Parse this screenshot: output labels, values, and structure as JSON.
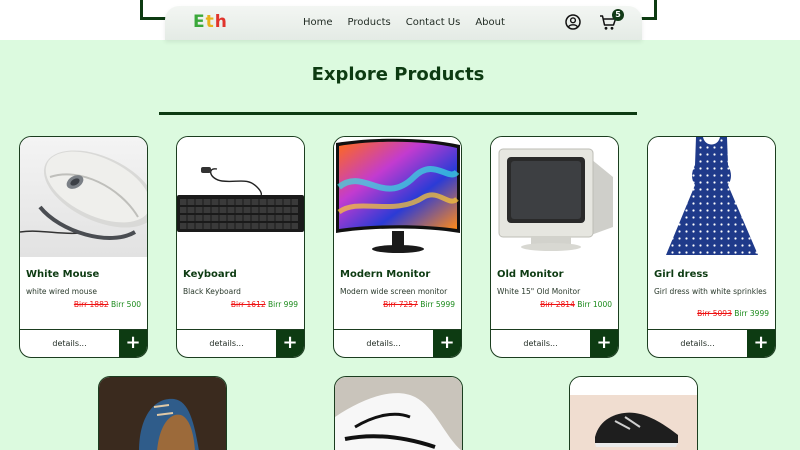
{
  "nav": {
    "logo": {
      "l1": "E",
      "l2": "t",
      "l3": "h"
    },
    "links": [
      "Home",
      "Products",
      "Contact Us",
      "About"
    ],
    "cart_count": "5"
  },
  "page": {
    "title": "Explore Products"
  },
  "products": [
    {
      "name": "White Mouse",
      "desc": "white wired mouse",
      "old_price": "Birr 1882",
      "price": "Birr 500",
      "details": "details...",
      "add": "+"
    },
    {
      "name": "Keyboard",
      "desc": "Black Keyboard",
      "old_price": "Birr 1612",
      "price": "Birr 999",
      "details": "details...",
      "add": "+"
    },
    {
      "name": "Modern Monitor",
      "desc": "Modern wide screen monitor",
      "old_price": "Birr 7257",
      "price": "Birr 5999",
      "details": "details...",
      "add": "+"
    },
    {
      "name": "Old Monitor",
      "desc": "White 15\" Old Monitor",
      "old_price": "Birr 2814",
      "price": "Birr 1000",
      "details": "details...",
      "add": "+"
    },
    {
      "name": "Girl dress",
      "desc": "Girl dress with white sprinkles",
      "old_price": "Birr 5093",
      "price": "Birr 3999",
      "details": "details...",
      "add": "+"
    }
  ],
  "colors": {
    "accent": "#0d3b12",
    "background": "#dcfadf",
    "old_price": "#ee1111",
    "new_price": "#1a8a1a"
  }
}
